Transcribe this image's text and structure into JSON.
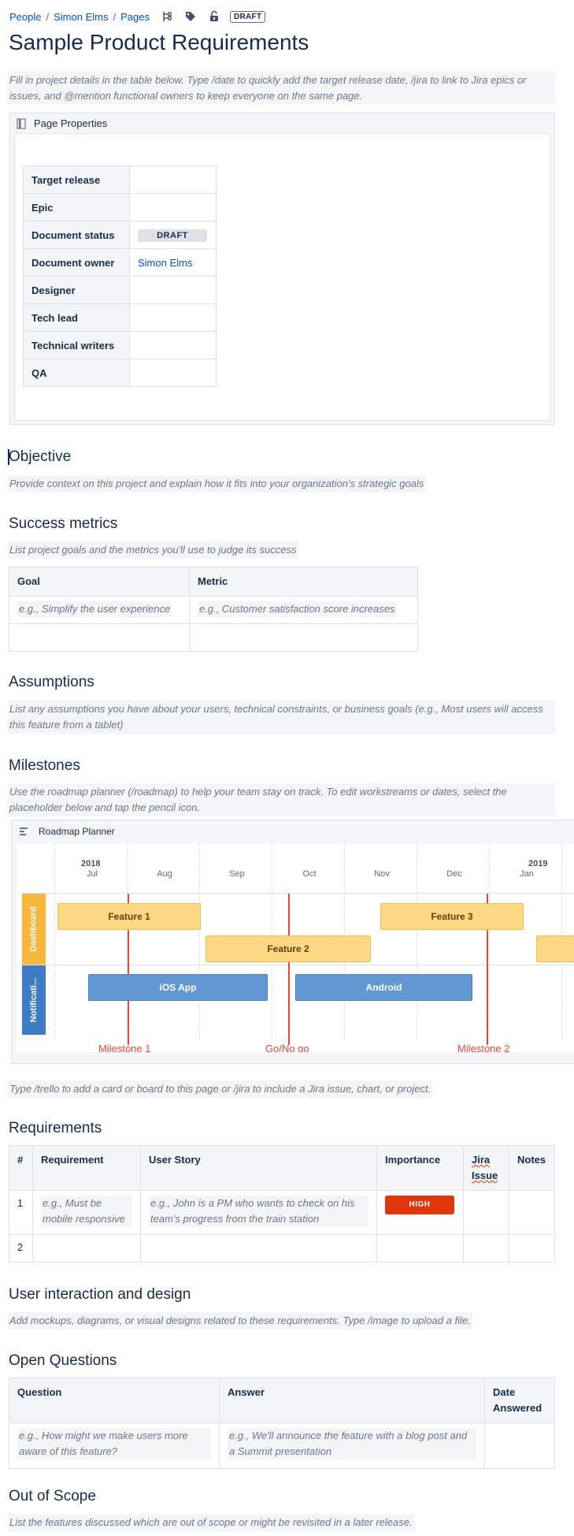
{
  "breadcrumbs": [
    "People",
    "Simon Elms",
    "Pages"
  ],
  "status_lozenge": "DRAFT",
  "title": "Sample Product Requirements",
  "intro": "Fill in project details in the table below. Type /date to quickly add the target release date, /jira to link to Jira epics or issues, and @mention functional owners to keep everyone on the same page.",
  "page_properties": {
    "header": "Page Properties",
    "rows": [
      {
        "key": "Target release",
        "value": ""
      },
      {
        "key": "Epic",
        "value": ""
      },
      {
        "key": "Document status",
        "value": "DRAFT"
      },
      {
        "key": "Document owner",
        "value": "Simon Elms"
      },
      {
        "key": "Designer",
        "value": ""
      },
      {
        "key": "Tech lead",
        "value": ""
      },
      {
        "key": "Technical writers",
        "value": ""
      },
      {
        "key": "QA",
        "value": ""
      }
    ]
  },
  "objective": {
    "heading": "Objective",
    "hint": "Provide context on this project and explain how it fits into your organization's strategic goals"
  },
  "success_metrics": {
    "heading": "Success metrics",
    "hint": "List project goals and the metrics you'll use to judge its success",
    "columns": [
      "Goal",
      "Metric"
    ],
    "rows": [
      [
        "e.g., Simplify the user experience",
        "e.g., Customer satisfaction score increases"
      ],
      [
        "",
        ""
      ]
    ]
  },
  "assumptions": {
    "heading": "Assumptions",
    "hint": "List any assumptions you have about your users, technical constraints, or business goals (e.g., Most users will access this feature from a tablet)"
  },
  "milestones": {
    "heading": "Milestones",
    "hint": "Use the roadmap planner (/roadmap) to help your team stay on track. To edit workstreams or dates, select the placeholder below and tap the pencil icon."
  },
  "roadmap": {
    "header": "Roadmap Planner",
    "years": [
      "2018",
      "2019"
    ],
    "months": [
      "Jul",
      "Aug",
      "Sep",
      "Oct",
      "Nov",
      "Dec",
      "Jan"
    ],
    "lanes": [
      {
        "name": "Dashboard",
        "color": "#f6b73c"
      },
      {
        "name": "Notificati...",
        "color": "#3d7bc4"
      }
    ],
    "bars": [
      "Feature 1",
      "Feature 2",
      "Feature 3",
      "iOS App",
      "Android"
    ],
    "milestones": [
      "Milestone 1",
      "Go/No go",
      "Milestone 2"
    ]
  },
  "trello_hint": "Type /trello to add a card or board to this page or /jira to include a Jira issue, chart, or project.",
  "requirements": {
    "heading": "Requirements",
    "columns": [
      "#",
      "Requirement",
      "User Story",
      "Importance",
      "Jira Issue",
      "Notes"
    ],
    "rows": [
      {
        "num": "1",
        "requirement": "e.g., Must be mobile responsive",
        "story": "e.g., John is a PM who wants to check on his team's progress from the train station",
        "importance": "HIGH"
      },
      {
        "num": "2",
        "requirement": "",
        "story": "",
        "importance": ""
      }
    ]
  },
  "user_interaction": {
    "heading": "User interaction and design",
    "hint": "Add mockups, diagrams, or visual designs related to these requirements. Type /image to upload a file."
  },
  "open_questions": {
    "heading": "Open Questions",
    "columns": [
      "Question",
      "Answer",
      "Date Answered"
    ],
    "rows": [
      [
        "e.g., How might we make users more aware of this feature?",
        "e.g., We'll announce the feature with a blog post and a Summit presentation",
        ""
      ]
    ]
  },
  "out_of_scope": {
    "heading": "Out of Scope",
    "hint": "List the features discussed which are out of scope or might be revisited in a later release."
  },
  "colors": {
    "link": "#0052cc",
    "milestone": "#de4c3f",
    "importance_high": "#de350b"
  }
}
